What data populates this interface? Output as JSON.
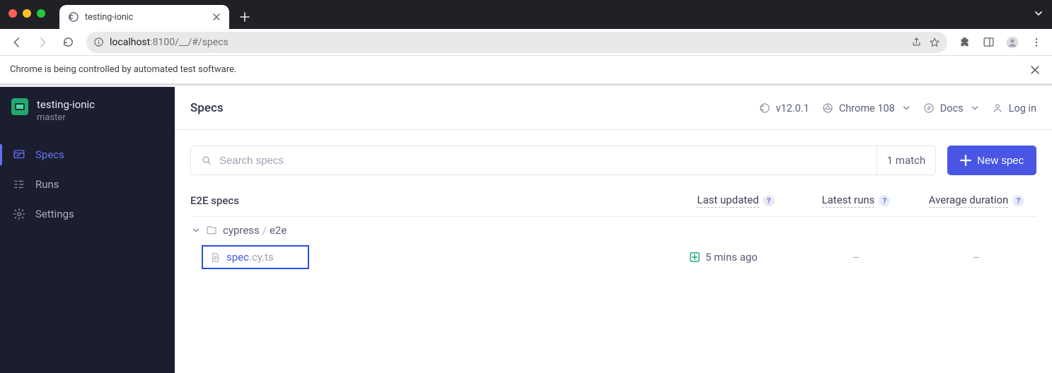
{
  "browser": {
    "tab_title": "testing-ionic",
    "url_host": "localhost",
    "url_port": ":8100",
    "url_path": "/__/#/specs",
    "infobar_message": "Chrome is being controlled by automated test software."
  },
  "sidebar": {
    "project_name": "testing-ionic",
    "branch": "master",
    "nav": {
      "specs": "Specs",
      "runs": "Runs",
      "settings": "Settings"
    }
  },
  "header": {
    "title": "Specs",
    "version": "v12.0.1",
    "browser_label": "Chrome 108",
    "docs_label": "Docs",
    "login_label": "Log in"
  },
  "search": {
    "placeholder": "Search specs",
    "match_text": "1 match",
    "new_spec_label": "New spec"
  },
  "table": {
    "heading": "E2E specs",
    "col_last_updated": "Last updated",
    "col_latest_runs": "Latest runs",
    "col_avg_duration": "Average duration",
    "folder_segment_1": "cypress",
    "folder_segment_2": "e2e",
    "spec_base": "spec",
    "spec_ext": ".cy.ts",
    "last_updated_value": "5 mins ago",
    "latest_runs_value": "--",
    "avg_duration_value": "--"
  }
}
